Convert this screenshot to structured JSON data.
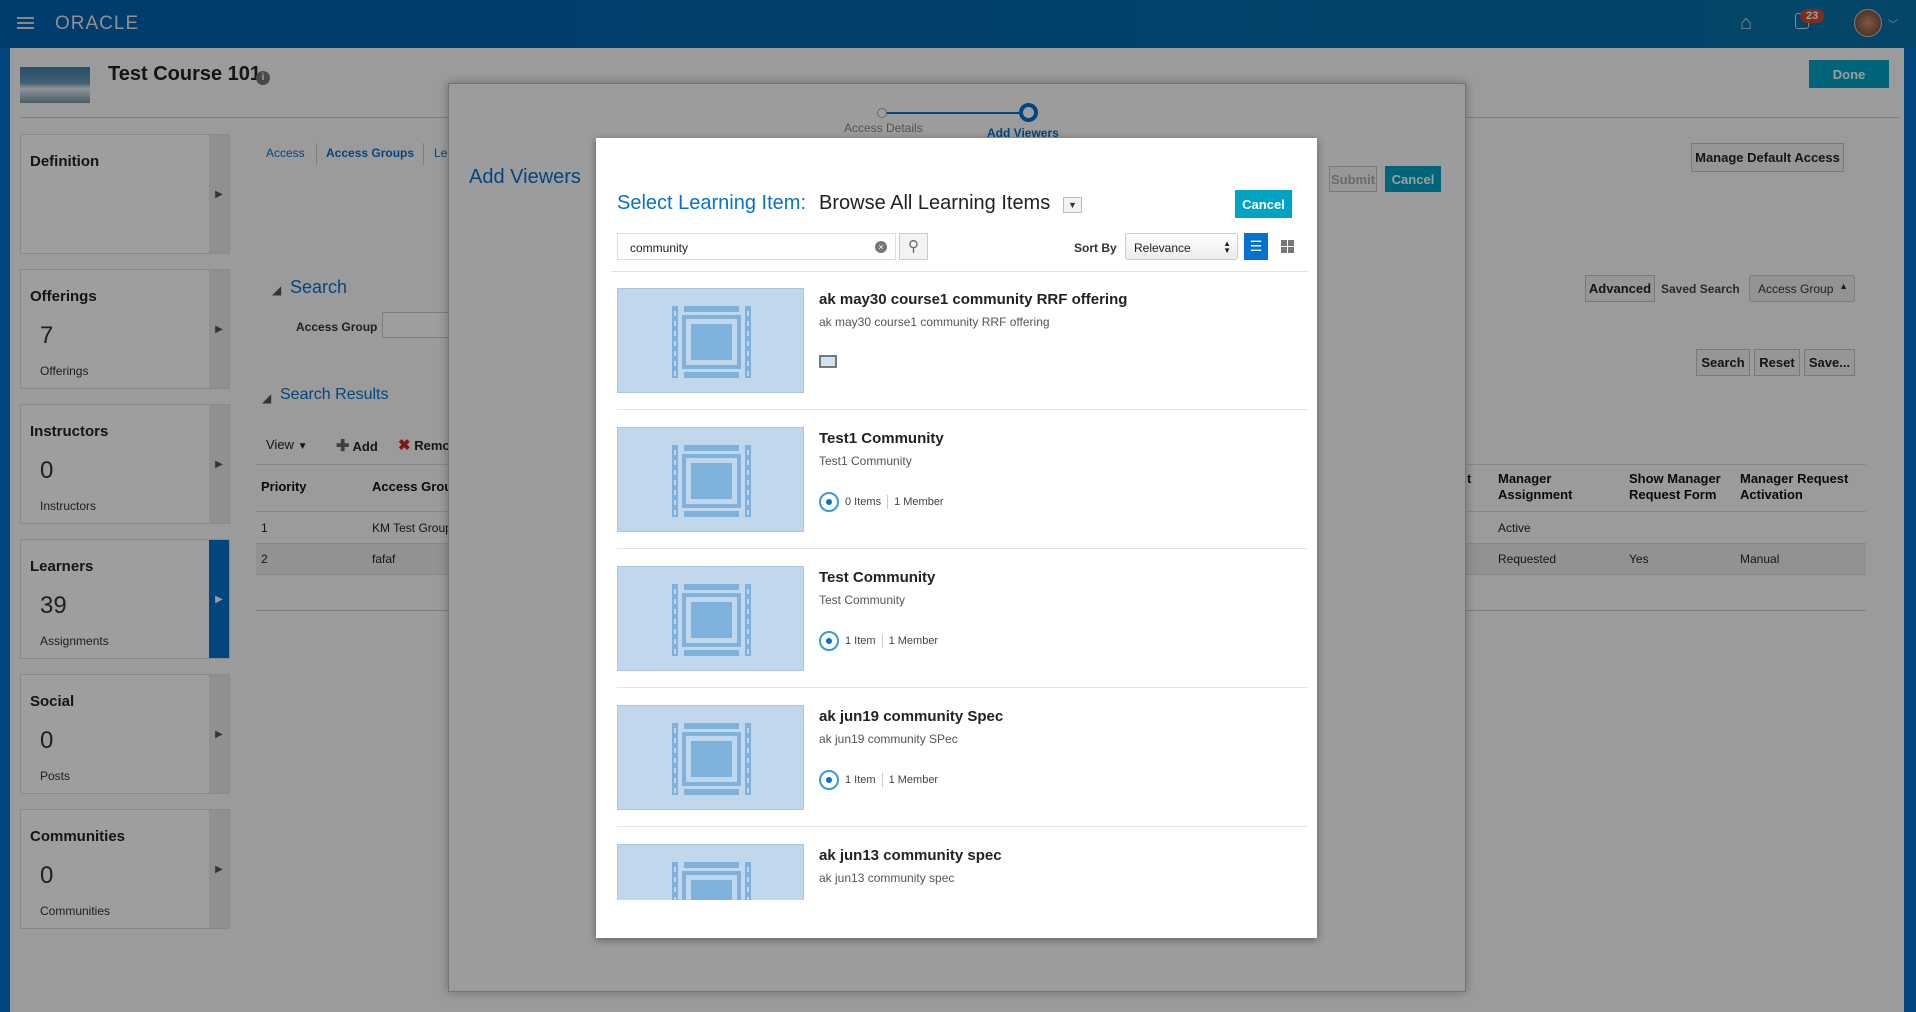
{
  "header": {
    "logo": "ORACLE",
    "notifications_count": "23",
    "icons": [
      "hamburger-menu-icon",
      "home-icon",
      "notifications-icon",
      "avatar",
      "chevron-down-icon"
    ]
  },
  "course": {
    "title": "Test Course 101",
    "done_label": "Done"
  },
  "cards": [
    {
      "title": "Definition",
      "count": "",
      "label": ""
    },
    {
      "title": "Offerings",
      "count": "7",
      "label": "Offerings"
    },
    {
      "title": "Instructors",
      "count": "0",
      "label": "Instructors"
    },
    {
      "title": "Learners",
      "count": "39",
      "label": "Assignments",
      "active": true
    },
    {
      "title": "Social",
      "count": "0",
      "label": "Posts"
    },
    {
      "title": "Communities",
      "count": "0",
      "label": "Communities"
    }
  ],
  "tabs": [
    "Access",
    "Access Groups",
    "Le"
  ],
  "manage_default_access": "Manage Default Access",
  "search": {
    "heading": "Search",
    "field_label": "Access Group",
    "advanced": "Advanced",
    "saved_search_label": "Saved Search",
    "saved_search_value": "Access Group",
    "search_btn": "Search",
    "reset_btn": "Reset",
    "save_btn": "Save..."
  },
  "results": {
    "heading": "Search Results",
    "view": "View",
    "add": "Add",
    "remove": "Remo",
    "columns": [
      "Priority",
      "Access Grou",
      "t",
      "Manager Assignment",
      "Show Manager Request Form",
      "Manager Request Activation"
    ],
    "rows": [
      [
        "1",
        "KM Test Group",
        "",
        "Active",
        "",
        ""
      ],
      [
        "2",
        "fafaf",
        "",
        "Requested",
        "Yes",
        "Manual"
      ]
    ]
  },
  "add_viewers": {
    "title": "Add Viewers",
    "steps": [
      "Access Details",
      "Add Viewers"
    ],
    "submit": "Submit",
    "cancel": "Cancel"
  },
  "modal": {
    "label": "Select Learning Item:",
    "browse": "Browse All Learning Items",
    "cancel": "Cancel",
    "search_value": "community",
    "sort_by_label": "Sort By",
    "sort_value": "Relevance",
    "accent": "#0572ce",
    "cancel_color": "#00a3c4",
    "items": [
      {
        "title": "ak may30 course1 community RRF offering",
        "subtitle": "ak may30 course1 community RRF offering",
        "type": "computer-icon",
        "items": "",
        "members": ""
      },
      {
        "title": "Test1 Community",
        "subtitle": "Test1 Community",
        "type": "community-icon",
        "items": "0 Items",
        "members": "1 Member"
      },
      {
        "title": "Test Community",
        "subtitle": "Test Community",
        "type": "community-icon",
        "items": "1 Item",
        "members": "1 Member"
      },
      {
        "title": "ak jun19 community Spec",
        "subtitle": "ak jun19 community SPec",
        "type": "community-icon",
        "items": "1 Item",
        "members": "1 Member"
      },
      {
        "title": "ak jun13 community spec",
        "subtitle": "ak jun13 community spec",
        "type": "community-icon",
        "items": "",
        "members": ""
      }
    ]
  }
}
